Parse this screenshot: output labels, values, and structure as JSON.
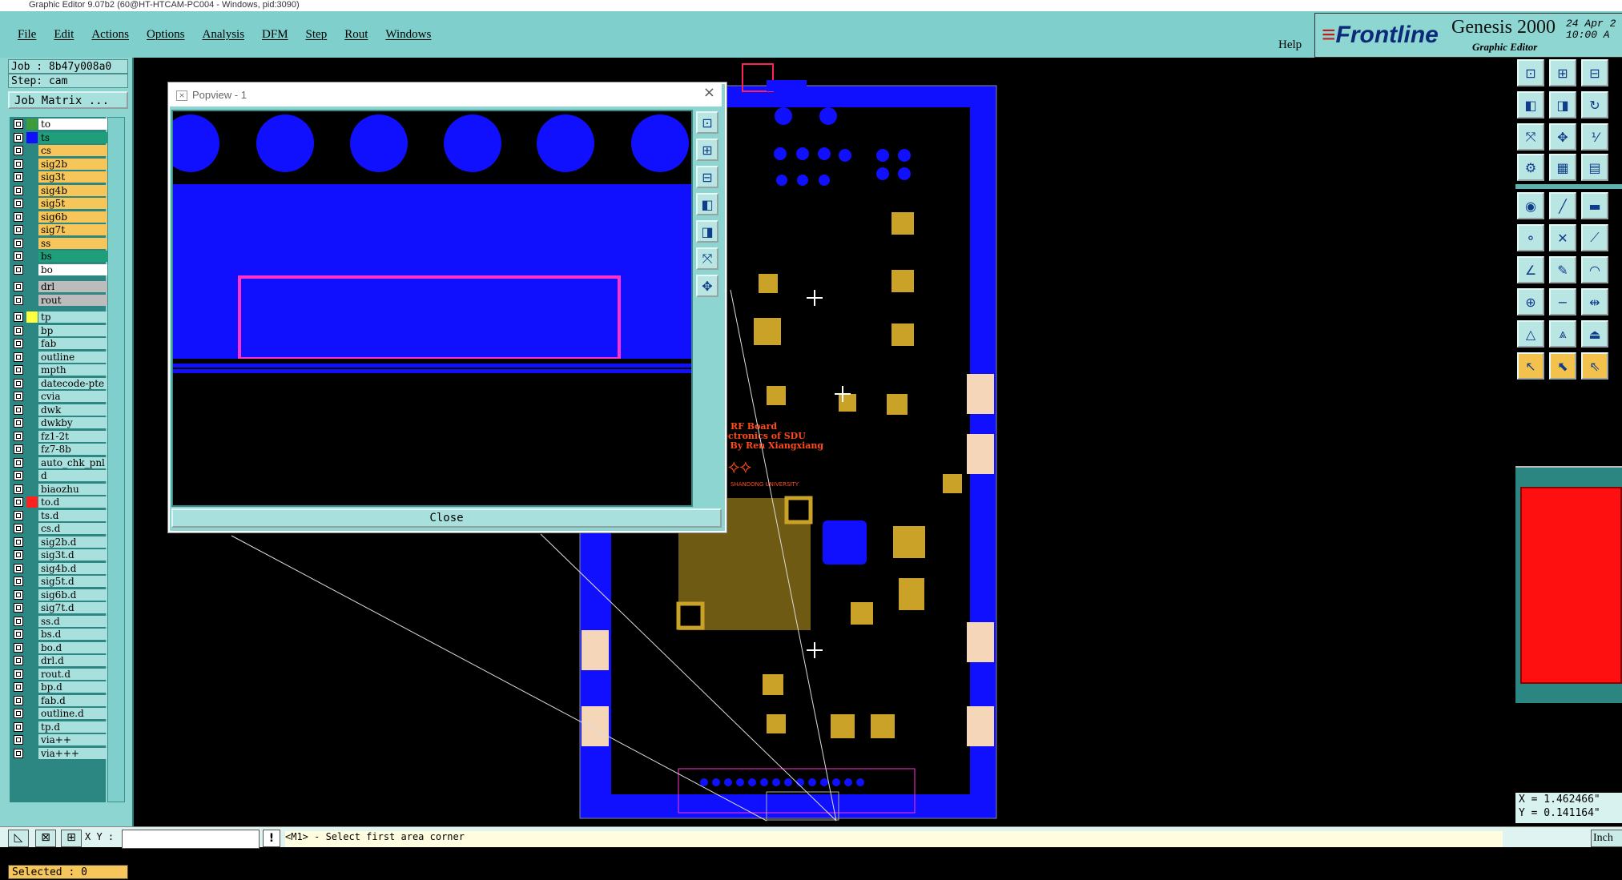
{
  "window_title": "Graphic Editor 9.07b2 (60@HT-HTCAM-PC004 - Windows, pid:3090)",
  "menu": [
    "File",
    "Edit",
    "Actions",
    "Options",
    "Analysis",
    "DFM",
    "Step",
    "Rout",
    "Windows"
  ],
  "help_label": "Help",
  "brand": {
    "logo": "Frontline",
    "product": "Genesis 2000",
    "subtitle": "Graphic Editor",
    "date": "24 Apr 2",
    "time": "10:00 A"
  },
  "job": {
    "job_line": "Job : 8b47y008a0",
    "step_line": "Step: cam",
    "matrix_button": "Job Matrix ..."
  },
  "layers": [
    {
      "name": "to",
      "swatch": "#3d9b3d",
      "bg": "#ffffff"
    },
    {
      "name": "ts",
      "swatch": "#1010ff",
      "bg": "#1f9e7a"
    },
    {
      "name": "cs",
      "swatch": "",
      "bg": "#f6c65a"
    },
    {
      "name": "sig2b",
      "swatch": "",
      "bg": "#f6c65a"
    },
    {
      "name": "sig3t",
      "swatch": "",
      "bg": "#f6c65a"
    },
    {
      "name": "sig4b",
      "swatch": "",
      "bg": "#f6c65a"
    },
    {
      "name": "sig5t",
      "swatch": "",
      "bg": "#f6c65a"
    },
    {
      "name": "sig6b",
      "swatch": "",
      "bg": "#f6c65a"
    },
    {
      "name": "sig7t",
      "swatch": "",
      "bg": "#f6c65a"
    },
    {
      "name": "ss",
      "swatch": "",
      "bg": "#f6c65a"
    },
    {
      "name": "bs",
      "swatch": "",
      "bg": "#1f9e7a"
    },
    {
      "name": "bo",
      "swatch": "",
      "bg": "#ffffff"
    },
    {
      "name": "drl",
      "swatch": "",
      "bg": "#bcbcbc"
    },
    {
      "name": "rout",
      "swatch": "",
      "bg": "#bcbcbc"
    },
    {
      "name": "tp",
      "swatch": "#ffff40",
      "bg": "#a7e0dc"
    },
    {
      "name": "bp",
      "swatch": "",
      "bg": "#a7e0dc"
    },
    {
      "name": "fab",
      "swatch": "",
      "bg": "#a7e0dc"
    },
    {
      "name": "outline",
      "swatch": "",
      "bg": "#a7e0dc"
    },
    {
      "name": "mpth",
      "swatch": "",
      "bg": "#a7e0dc"
    },
    {
      "name": "datecode-pte",
      "swatch": "",
      "bg": "#a7e0dc"
    },
    {
      "name": "cvia",
      "swatch": "",
      "bg": "#a7e0dc"
    },
    {
      "name": "dwk",
      "swatch": "",
      "bg": "#a7e0dc"
    },
    {
      "name": "dwkby",
      "swatch": "",
      "bg": "#a7e0dc"
    },
    {
      "name": "fz1-2t",
      "swatch": "",
      "bg": "#a7e0dc"
    },
    {
      "name": "fz7-8b",
      "swatch": "",
      "bg": "#a7e0dc"
    },
    {
      "name": "auto_chk_pnl",
      "swatch": "",
      "bg": "#a7e0dc"
    },
    {
      "name": "d",
      "swatch": "",
      "bg": "#a7e0dc"
    },
    {
      "name": "biaozhu",
      "swatch": "",
      "bg": "#a7e0dc"
    },
    {
      "name": "to.d",
      "swatch": "#ff2020",
      "bg": "#a7e0dc"
    },
    {
      "name": "ts.d",
      "swatch": "",
      "bg": "#a7e0dc"
    },
    {
      "name": "cs.d",
      "swatch": "",
      "bg": "#a7e0dc"
    },
    {
      "name": "sig2b.d",
      "swatch": "",
      "bg": "#a7e0dc"
    },
    {
      "name": "sig3t.d",
      "swatch": "",
      "bg": "#a7e0dc"
    },
    {
      "name": "sig4b.d",
      "swatch": "",
      "bg": "#a7e0dc"
    },
    {
      "name": "sig5t.d",
      "swatch": "",
      "bg": "#a7e0dc"
    },
    {
      "name": "sig6b.d",
      "swatch": "",
      "bg": "#a7e0dc"
    },
    {
      "name": "sig7t.d",
      "swatch": "",
      "bg": "#a7e0dc"
    },
    {
      "name": "ss.d",
      "swatch": "",
      "bg": "#a7e0dc"
    },
    {
      "name": "bs.d",
      "swatch": "",
      "bg": "#a7e0dc"
    },
    {
      "name": "bo.d",
      "swatch": "",
      "bg": "#a7e0dc"
    },
    {
      "name": "drl.d",
      "swatch": "",
      "bg": "#a7e0dc"
    },
    {
      "name": "rout.d",
      "swatch": "",
      "bg": "#a7e0dc"
    },
    {
      "name": "bp.d",
      "swatch": "",
      "bg": "#a7e0dc"
    },
    {
      "name": "fab.d",
      "swatch": "",
      "bg": "#a7e0dc"
    },
    {
      "name": "outline.d",
      "swatch": "",
      "bg": "#a7e0dc"
    },
    {
      "name": "tp.d",
      "swatch": "",
      "bg": "#a7e0dc"
    },
    {
      "name": "via++",
      "swatch": "",
      "bg": "#a7e0dc"
    },
    {
      "name": "via+++",
      "swatch": "",
      "bg": "#a7e0dc"
    }
  ],
  "selected_text": "Selected : 0",
  "status": {
    "xy_label": "X Y :",
    "xy_value": "",
    "prompt": "<M1> - Select first area corner",
    "units": "Inch"
  },
  "coords": {
    "x": "X = 1.462466\"",
    "y": "Y = 0.141164\""
  },
  "popview": {
    "title": "Popview - 1",
    "close_label": "Close"
  },
  "board_labels": {
    "line1": "RF Board",
    "line2": "ectronics of SDU",
    "line3": "d By Ren Xiangxiang",
    "university": "SHANDONG UNIVERSITY"
  },
  "colors": {
    "menubar": "#7fd0cc",
    "layer_active": "#f6c65a",
    "pcb_blue": "#1010ff",
    "pad_gold": "#c9a227",
    "highlight_magenta": "#ff33cc"
  }
}
